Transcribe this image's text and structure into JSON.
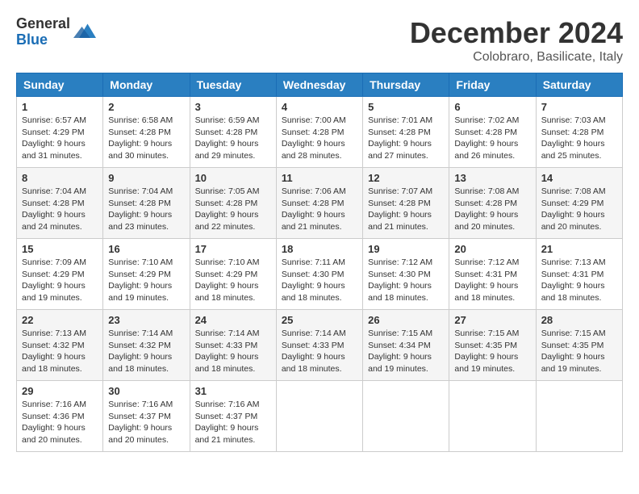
{
  "header": {
    "logo_general": "General",
    "logo_blue": "Blue",
    "title": "December 2024",
    "subtitle": "Colobraro, Basilicate, Italy"
  },
  "days": [
    "Sunday",
    "Monday",
    "Tuesday",
    "Wednesday",
    "Thursday",
    "Friday",
    "Saturday"
  ],
  "weeks": [
    [
      {
        "day": "1",
        "sunrise": "6:57 AM",
        "sunset": "4:29 PM",
        "daylight": "9 hours and 31 minutes."
      },
      {
        "day": "2",
        "sunrise": "6:58 AM",
        "sunset": "4:28 PM",
        "daylight": "9 hours and 30 minutes."
      },
      {
        "day": "3",
        "sunrise": "6:59 AM",
        "sunset": "4:28 PM",
        "daylight": "9 hours and 29 minutes."
      },
      {
        "day": "4",
        "sunrise": "7:00 AM",
        "sunset": "4:28 PM",
        "daylight": "9 hours and 28 minutes."
      },
      {
        "day": "5",
        "sunrise": "7:01 AM",
        "sunset": "4:28 PM",
        "daylight": "9 hours and 27 minutes."
      },
      {
        "day": "6",
        "sunrise": "7:02 AM",
        "sunset": "4:28 PM",
        "daylight": "9 hours and 26 minutes."
      },
      {
        "day": "7",
        "sunrise": "7:03 AM",
        "sunset": "4:28 PM",
        "daylight": "9 hours and 25 minutes."
      }
    ],
    [
      {
        "day": "8",
        "sunrise": "7:04 AM",
        "sunset": "4:28 PM",
        "daylight": "9 hours and 24 minutes."
      },
      {
        "day": "9",
        "sunrise": "7:04 AM",
        "sunset": "4:28 PM",
        "daylight": "9 hours and 23 minutes."
      },
      {
        "day": "10",
        "sunrise": "7:05 AM",
        "sunset": "4:28 PM",
        "daylight": "9 hours and 22 minutes."
      },
      {
        "day": "11",
        "sunrise": "7:06 AM",
        "sunset": "4:28 PM",
        "daylight": "9 hours and 21 minutes."
      },
      {
        "day": "12",
        "sunrise": "7:07 AM",
        "sunset": "4:28 PM",
        "daylight": "9 hours and 21 minutes."
      },
      {
        "day": "13",
        "sunrise": "7:08 AM",
        "sunset": "4:28 PM",
        "daylight": "9 hours and 20 minutes."
      },
      {
        "day": "14",
        "sunrise": "7:08 AM",
        "sunset": "4:29 PM",
        "daylight": "9 hours and 20 minutes."
      }
    ],
    [
      {
        "day": "15",
        "sunrise": "7:09 AM",
        "sunset": "4:29 PM",
        "daylight": "9 hours and 19 minutes."
      },
      {
        "day": "16",
        "sunrise": "7:10 AM",
        "sunset": "4:29 PM",
        "daylight": "9 hours and 19 minutes."
      },
      {
        "day": "17",
        "sunrise": "7:10 AM",
        "sunset": "4:29 PM",
        "daylight": "9 hours and 18 minutes."
      },
      {
        "day": "18",
        "sunrise": "7:11 AM",
        "sunset": "4:30 PM",
        "daylight": "9 hours and 18 minutes."
      },
      {
        "day": "19",
        "sunrise": "7:12 AM",
        "sunset": "4:30 PM",
        "daylight": "9 hours and 18 minutes."
      },
      {
        "day": "20",
        "sunrise": "7:12 AM",
        "sunset": "4:31 PM",
        "daylight": "9 hours and 18 minutes."
      },
      {
        "day": "21",
        "sunrise": "7:13 AM",
        "sunset": "4:31 PM",
        "daylight": "9 hours and 18 minutes."
      }
    ],
    [
      {
        "day": "22",
        "sunrise": "7:13 AM",
        "sunset": "4:32 PM",
        "daylight": "9 hours and 18 minutes."
      },
      {
        "day": "23",
        "sunrise": "7:14 AM",
        "sunset": "4:32 PM",
        "daylight": "9 hours and 18 minutes."
      },
      {
        "day": "24",
        "sunrise": "7:14 AM",
        "sunset": "4:33 PM",
        "daylight": "9 hours and 18 minutes."
      },
      {
        "day": "25",
        "sunrise": "7:14 AM",
        "sunset": "4:33 PM",
        "daylight": "9 hours and 18 minutes."
      },
      {
        "day": "26",
        "sunrise": "7:15 AM",
        "sunset": "4:34 PM",
        "daylight": "9 hours and 19 minutes."
      },
      {
        "day": "27",
        "sunrise": "7:15 AM",
        "sunset": "4:35 PM",
        "daylight": "9 hours and 19 minutes."
      },
      {
        "day": "28",
        "sunrise": "7:15 AM",
        "sunset": "4:35 PM",
        "daylight": "9 hours and 19 minutes."
      }
    ],
    [
      {
        "day": "29",
        "sunrise": "7:16 AM",
        "sunset": "4:36 PM",
        "daylight": "9 hours and 20 minutes."
      },
      {
        "day": "30",
        "sunrise": "7:16 AM",
        "sunset": "4:37 PM",
        "daylight": "9 hours and 20 minutes."
      },
      {
        "day": "31",
        "sunrise": "7:16 AM",
        "sunset": "4:37 PM",
        "daylight": "9 hours and 21 minutes."
      },
      null,
      null,
      null,
      null
    ]
  ]
}
